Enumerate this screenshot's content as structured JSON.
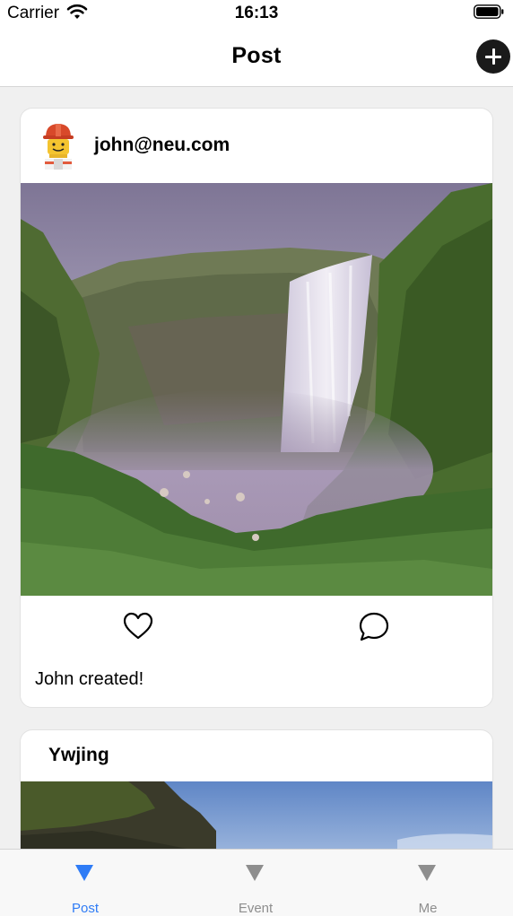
{
  "status_bar": {
    "carrier": "Carrier",
    "time": "16:13",
    "wifi_icon": "wifi-icon",
    "battery_icon": "battery-icon"
  },
  "nav": {
    "title": "Post",
    "add_icon": "plus-circle-icon"
  },
  "posts": [
    {
      "username": "john@neu.com",
      "avatar": "lego-figure-avatar",
      "image": "waterfall-photo",
      "like_icon": "heart-outline-icon",
      "comment_icon": "speech-bubble-icon",
      "caption": "John created!"
    },
    {
      "username": "Ywjing",
      "image": "cliff-sky-photo"
    }
  ],
  "tabs": [
    {
      "label": "Post",
      "icon": "triangle-down-icon",
      "selected": true
    },
    {
      "label": "Event",
      "icon": "triangle-down-icon",
      "selected": false
    },
    {
      "label": "Me",
      "icon": "triangle-down-icon",
      "selected": false
    }
  ],
  "colors": {
    "accent": "#2f7cf6",
    "inactive_tab": "#8e8e8e",
    "background": "#f0f0f0"
  }
}
